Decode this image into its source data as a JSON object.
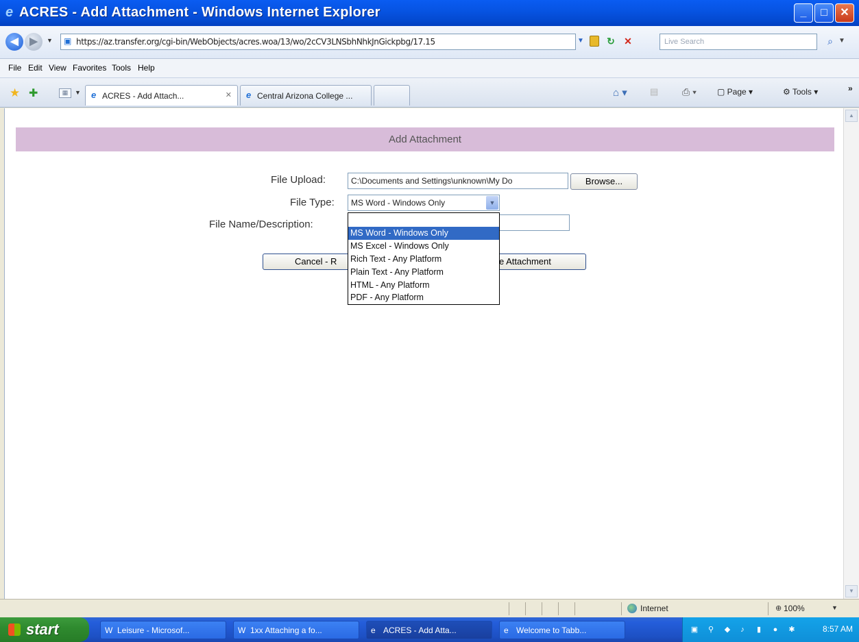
{
  "window": {
    "title": "ACRES - Add Attachment - Windows Internet Explorer",
    "minimize": "_",
    "maximize": "□",
    "close": "✕"
  },
  "address_bar": {
    "url": "https://az.transfer.org/cgi-bin/WebObjects/acres.woa/13/wo/2cCV3LNSbhNhkJnGickpbg/17.15",
    "search_placeholder": "Live Search"
  },
  "menu": [
    "File",
    "Edit",
    "View",
    "Favorites",
    "Tools",
    "Help"
  ],
  "tabs": [
    {
      "label": "ACRES - Add Attach...",
      "active": true
    },
    {
      "label": "Central Arizona College ...",
      "active": false
    }
  ],
  "command_bar": {
    "page_label": "Page",
    "tools_label": "Tools",
    "more": "»"
  },
  "page": {
    "header_title": "Add Attachment",
    "file_upload_label": "File Upload:",
    "file_upload_value": "C:\\Documents and Settings\\unknown\\My Do",
    "browse_label": "Browse...",
    "file_type_label": "File Type:",
    "file_type_selected": "MS Word - Windows Only",
    "file_name_label": "File Name/Description:",
    "file_name_value": "",
    "cancel_label": "Cancel - R",
    "save_label": "e Attachment",
    "file_type_options": [
      "MS Word - Windows Only",
      "MS Excel - Windows Only",
      "Rich Text - Any Platform",
      "Plain Text - Any Platform",
      "HTML - Any Platform",
      "PDF - Any Platform"
    ]
  },
  "status_bar": {
    "zone": "Internet",
    "zoom": "100%"
  },
  "taskbar": {
    "start_label": "start",
    "items": [
      {
        "label": "Leisure - Microsof..."
      },
      {
        "label": "1xx Attaching a fo..."
      },
      {
        "label": "ACRES - Add Atta..."
      },
      {
        "label": "Welcome to Tabb..."
      }
    ],
    "clock": "8:57 AM"
  }
}
